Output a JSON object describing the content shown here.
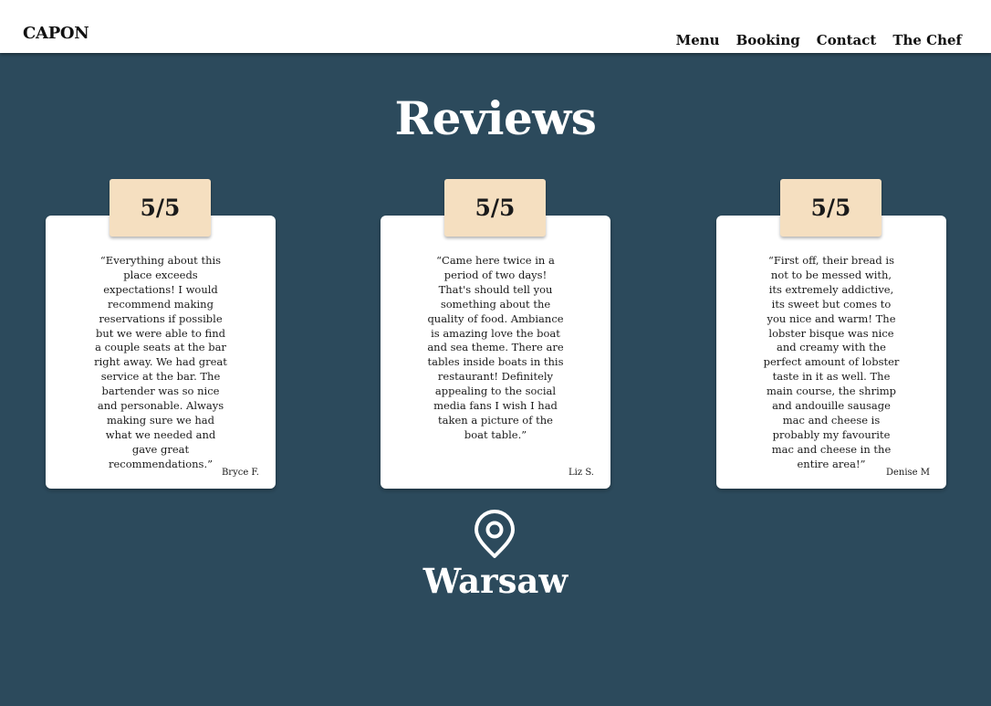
{
  "header": {
    "logo": "CAPON",
    "nav": [
      "Menu",
      "Booking",
      "Contact",
      "The Chef"
    ]
  },
  "main": {
    "title": "Reviews",
    "reviews": [
      {
        "rating": "5/5",
        "text": "“Everything about this place exceeds expectations! I would recommend making reservations if possible but we were able to find a couple seats at the bar right away. We had great service at the bar. The bartender was so nice and personable. Always making sure we had what we needed and gave great recommendations.”",
        "author": "Bryce F."
      },
      {
        "rating": "5/5",
        "text": "“Came here twice in a period of two days! That's should tell you something about the quality of food. Ambiance is amazing love the boat and sea theme. There are tables inside boats in this restaurant! Definitely appealing to the social media fans I wish I had taken a picture of the boat table.”",
        "author": "Liz S."
      },
      {
        "rating": "5/5",
        "text": "“First off, their bread is not to be messed with, its extremely addictive, its sweet but comes to you nice and warm! The lobster bisque was nice and creamy with the perfect amount of lobster taste in it as well. The main course, the shrimp and andouille sausage mac and cheese is probably my favourite mac and cheese in the entire area!”",
        "author": "Denise M"
      }
    ],
    "location": {
      "icon": "map-pin-icon",
      "name": "Warsaw"
    }
  },
  "colors": {
    "background": "#2c4a5c",
    "rating_badge": "#f5dfc0",
    "card": "#ffffff"
  }
}
